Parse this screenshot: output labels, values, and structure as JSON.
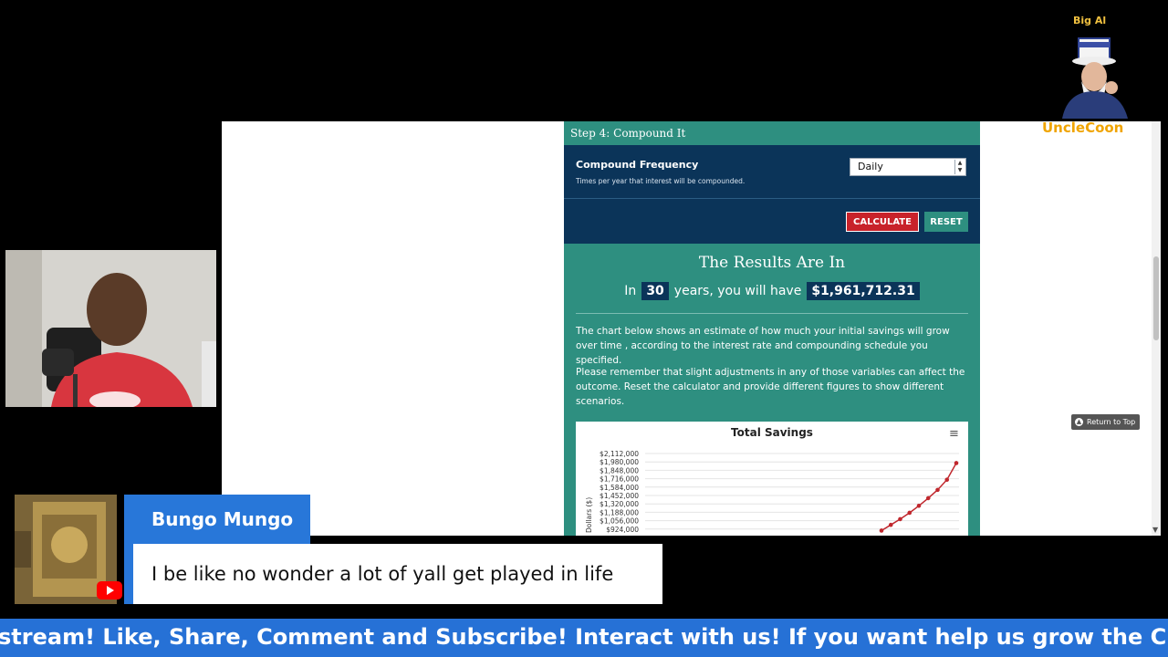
{
  "calculator": {
    "step_header": "Step 4: Compound It",
    "frequency": {
      "label": "Compound Frequency",
      "help": "Times per year that interest will be compounded.",
      "selected": "Daily"
    },
    "buttons": {
      "calculate": "CALCULATE",
      "reset": "RESET"
    },
    "results": {
      "title": "The Results Are In",
      "prefix": "In",
      "years": "30",
      "middle": "years, you will have",
      "amount": "$1,961,712.31"
    },
    "paragraph1": "The chart below shows an estimate of how much your initial savings will grow over time , according to the interest rate and compounding schedule you specified.",
    "paragraph2": "Please remember that slight adjustments in any of those variables can affect the outcome. Reset the calculator and provide different figures to show different scenarios."
  },
  "chart_data": {
    "type": "line",
    "title": "Total Savings",
    "ylabel": "Dollars ($)",
    "xlabel": "",
    "y_ticks": [
      "$2,112,000",
      "$1,980,000",
      "$1,848,000",
      "$1,716,000",
      "$1,584,000",
      "$1,452,000",
      "$1,320,000",
      "$1,188,000",
      "$1,056,000",
      "$924,000"
    ],
    "ylim": [
      924000,
      2112000
    ],
    "series": [
      {
        "x": [
          22,
          23,
          24,
          25,
          26,
          27,
          28,
          29,
          30
        ],
        "values": [
          900000,
          990000,
          1080000,
          1180000,
          1290000,
          1410000,
          1540000,
          1700000,
          1961712
        ],
        "color": "#c0272d"
      }
    ],
    "grid": true,
    "legend": "none"
  },
  "return_to_top": "Return to Top",
  "logo": {
    "name": "Big Al",
    "brand": "UncleCoon"
  },
  "chat": {
    "author": "Bungo Mungo",
    "message": "I be like no wonder a lot of yall get played in life"
  },
  "ticker": "stream! Like, Share, Comment and Subscribe! Interact with us! If you want help us grow the Channel send us",
  "colors": {
    "teal": "#2e8f80",
    "navy": "#0b3459",
    "red_button": "#c8222a",
    "chat_blue": "#2877d9",
    "ticker_blue": "#2671d6",
    "logo_gold": "#f0a400"
  }
}
